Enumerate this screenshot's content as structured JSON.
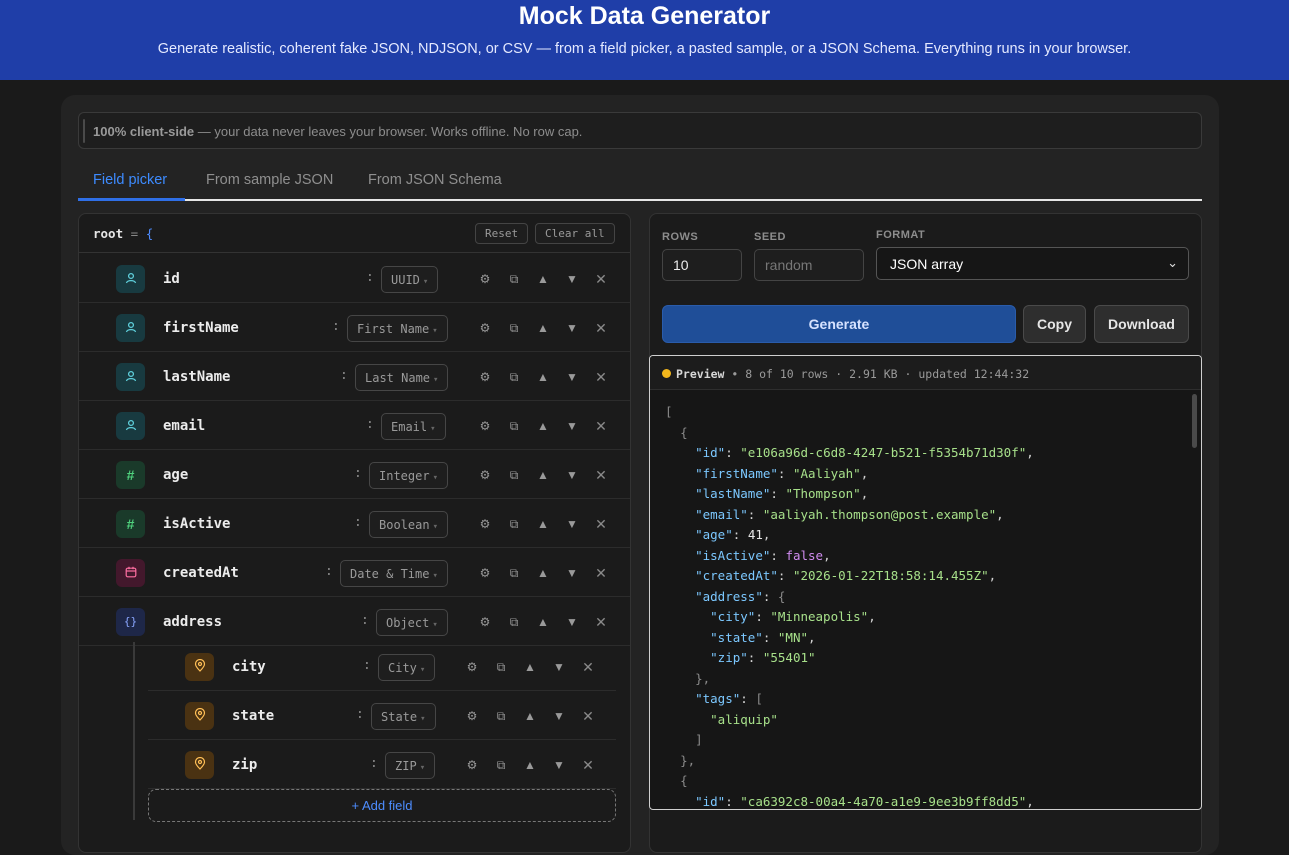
{
  "header": {
    "title": "Mock Data Generator",
    "subtitle": "Generate realistic, coherent fake JSON, NDJSON, or CSV — from a field picker, a pasted sample, or a JSON Schema. Everything runs in your browser."
  },
  "banner": {
    "strong": "100% client-side",
    "text": "— your data never leaves your browser. Works offline. No row cap."
  },
  "tabs": [
    {
      "label": "Field picker",
      "active": true
    },
    {
      "label": "From sample JSON",
      "active": false
    },
    {
      "label": "From JSON Schema",
      "active": false
    }
  ],
  "tree": {
    "root_label": "root",
    "root_eq": "=",
    "root_brace": "{",
    "reset_label": "Reset",
    "clear_label": "Clear all",
    "fields": [
      {
        "name": "id",
        "type": "UUID",
        "icon": "user-icon"
      },
      {
        "name": "firstName",
        "type": "First Name",
        "icon": "user-icon"
      },
      {
        "name": "lastName",
        "type": "Last Name",
        "icon": "user-icon"
      },
      {
        "name": "email",
        "type": "Email",
        "icon": "user-icon"
      },
      {
        "name": "age",
        "type": "Integer",
        "icon": "hash-icon"
      },
      {
        "name": "isActive",
        "type": "Boolean",
        "icon": "hash-icon"
      },
      {
        "name": "createdAt",
        "type": "Date & Time",
        "icon": "calendar-icon"
      },
      {
        "name": "address",
        "type": "Object",
        "icon": "braces-icon"
      }
    ],
    "children": [
      {
        "name": "city",
        "type": "City",
        "icon": "map-pin-icon"
      },
      {
        "name": "state",
        "type": "State",
        "icon": "map-pin-icon"
      },
      {
        "name": "zip",
        "type": "ZIP",
        "icon": "map-pin-icon"
      }
    ],
    "add_field_label": "+ Add field"
  },
  "controls": {
    "rows_label": "ROWS",
    "rows_value": "10",
    "seed_label": "SEED",
    "seed_placeholder": "random",
    "format_label": "FORMAT",
    "format_value": "JSON array",
    "generate_label": "Generate",
    "copy_label": "Copy",
    "download_label": "Download"
  },
  "preview": {
    "title": "Preview",
    "meta": "• 8 of 10 rows · 2.91 KB · updated 12:44:32",
    "record1": {
      "id": "\"e106a96d-c6d8-4247-b521-f5354b71d30f\"",
      "firstName": "\"Aaliyah\"",
      "lastName": "\"Thompson\"",
      "email": "\"aaliyah.thompson@post.example\"",
      "age": "41",
      "isActive": "false",
      "createdAt": "\"2026-01-22T18:58:14.455Z\"",
      "city": "\"Minneapolis\"",
      "state": "\"MN\"",
      "zip": "\"55401\"",
      "tag": "\"aliquip\""
    },
    "record2": {
      "id": "\"ca6392c8-00a4-4a70-a1e9-9ee3b9ff8dd5\""
    }
  }
}
